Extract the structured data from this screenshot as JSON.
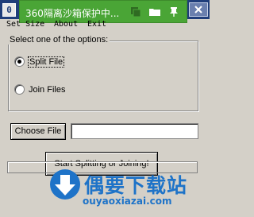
{
  "window": {
    "app_icon_letter": "0"
  },
  "sandbox_overlay": {
    "title": "360隔离沙箱保护中...",
    "icons": [
      "user-icon",
      "folder-icon",
      "pin-icon"
    ],
    "accent": "#4aa536"
  },
  "menu": {
    "items": [
      "Set Size",
      "About",
      "Exit"
    ]
  },
  "options": {
    "legend": "Select one of the options:",
    "split_label": "Split File",
    "join_label": "Join Files",
    "selected": "Split File"
  },
  "file": {
    "choose_button": "Choose File",
    "path_value": ""
  },
  "actions": {
    "start_button": "Start Splitting or Joining!"
  },
  "progress": {
    "value": 0
  },
  "watermark": {
    "text": "偶要下载站",
    "url": "ouyaoxiazai.com",
    "color": "#1e73c8"
  }
}
